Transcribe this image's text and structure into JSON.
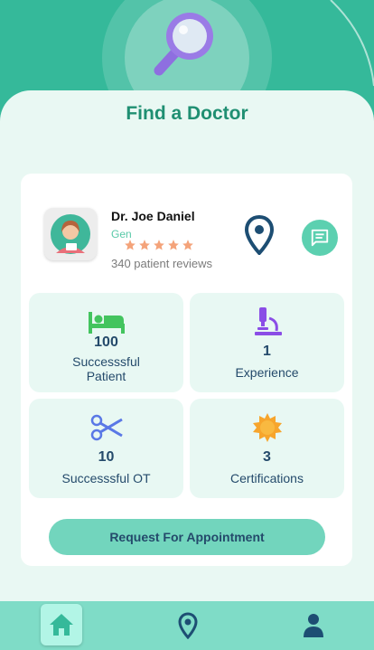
{
  "page": {
    "title": "Find a Doctor"
  },
  "doctor": {
    "name": "Dr. Joe Daniel",
    "specialty": "Gen",
    "rating": 5,
    "reviews": "340 patient reviews"
  },
  "stats": [
    {
      "icon": "bed-icon",
      "value": "100",
      "label": "Successsful Patient"
    },
    {
      "icon": "microscope-icon",
      "value": "1",
      "label": "Experience"
    },
    {
      "icon": "scissors-icon",
      "value": "10",
      "label": "Successsful OT"
    },
    {
      "icon": "certificate-badge-icon",
      "value": "3",
      "label": "Certifications"
    }
  ],
  "cta": {
    "label": "Request For Appointment"
  },
  "nav": {
    "active": "home",
    "items": [
      "home-icon",
      "location-pin-icon",
      "user-icon"
    ]
  },
  "colors": {
    "primary": "#35b99a",
    "sheet": "#e9f8f3",
    "title": "#1f8f72",
    "text_dark": "#244a6b",
    "star": "#f4a37a",
    "button": "#72d5bd",
    "tabbar": "#7fdcc7"
  }
}
